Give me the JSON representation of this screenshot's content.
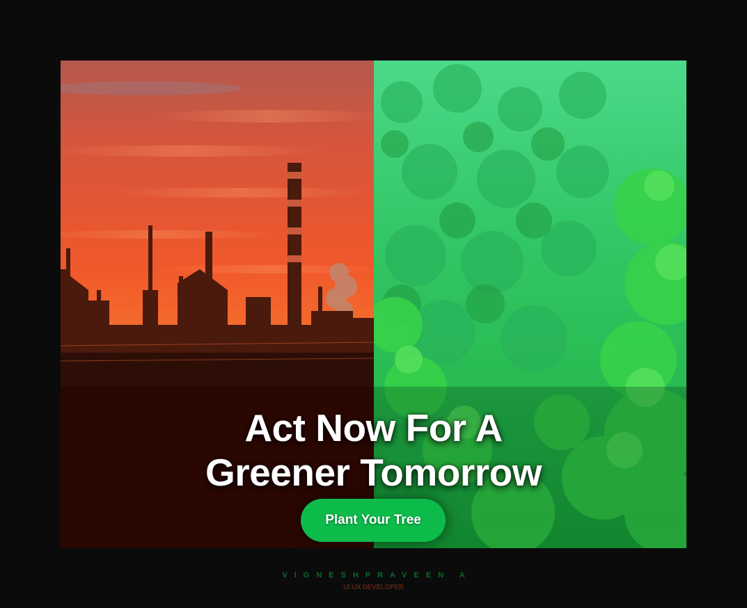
{
  "banner": {
    "headline_line1": "Act Now For A",
    "headline_line2": "Greener Tomorrow",
    "cta_label": "Plant Your Tree",
    "left_image": "industrial-sunset-photo",
    "right_image": "green-forest-photo"
  },
  "credit": {
    "name": "VIGNESHPRAVEEN A",
    "role": "UI UX DEVELOPER"
  },
  "colors": {
    "background": "#0b0b0b",
    "cta_green": "#0dbb4a",
    "sunset_orange": "#e8502a",
    "forest_green": "#2fc862"
  }
}
